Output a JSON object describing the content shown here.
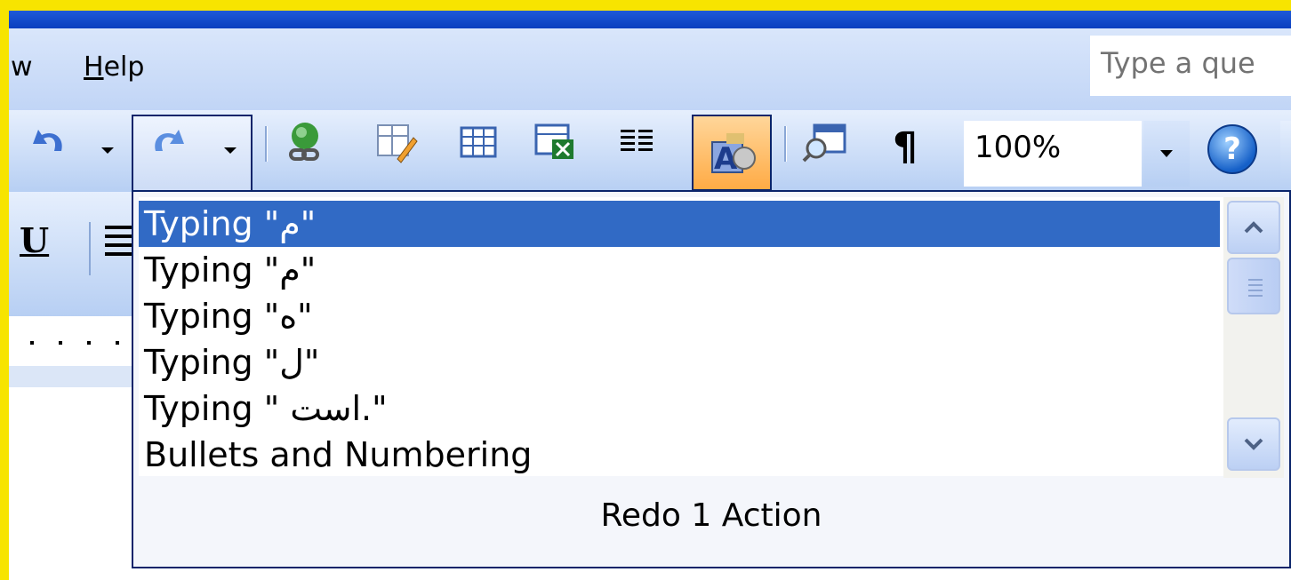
{
  "menubar": {
    "view_label": "w",
    "help_label": "Help",
    "ask_placeholder": "Type a que"
  },
  "toolbar": {
    "zoom_value": "100%",
    "pilcrow": "¶",
    "help_glyph": "?"
  },
  "formatting": {
    "underline_label": "U"
  },
  "redo_dropdown": {
    "items": [
      "Typing \"م\"",
      "Typing \"م\"",
      "Typing \"ه\"",
      "Typing \"ل\"",
      "Typing \" است.\"",
      "Bullets and Numbering"
    ],
    "selected_index": 0,
    "footer": "Redo 1 Action"
  },
  "colors": {
    "selection": "#316ac5",
    "toolbar_bg": "#c1d5f6",
    "highlight_border": "#0a246a",
    "frame_yellow": "#f7e400"
  }
}
